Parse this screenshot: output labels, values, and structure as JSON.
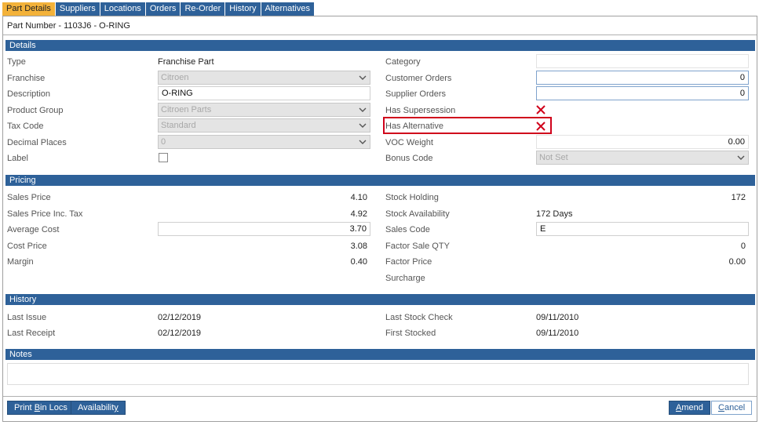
{
  "tabs": [
    {
      "label": "Part Details",
      "active": true
    },
    {
      "label": "Suppliers",
      "active": false
    },
    {
      "label": "Locations",
      "active": false
    },
    {
      "label": "Orders",
      "active": false
    },
    {
      "label": "Re-Order",
      "active": false
    },
    {
      "label": "History",
      "active": false
    },
    {
      "label": "Alternatives",
      "active": false
    }
  ],
  "part_title": "Part Number - 1103J6 - O-RING",
  "sections": {
    "details": "Details",
    "pricing": "Pricing",
    "history": "History",
    "notes": "Notes"
  },
  "details": {
    "type_label": "Type",
    "type_value": "Franchise Part",
    "franchise_label": "Franchise",
    "franchise_value": "Citroen",
    "description_label": "Description",
    "description_value": "O-RING",
    "product_group_label": "Product Group",
    "product_group_value": "Citroen Parts",
    "tax_code_label": "Tax Code",
    "tax_code_value": "Standard",
    "decimal_places_label": "Decimal Places",
    "decimal_places_value": "0",
    "label_label": "Label",
    "label_checked": false,
    "category_label": "Category",
    "category_value": "",
    "customer_orders_label": "Customer Orders",
    "customer_orders_value": "0",
    "supplier_orders_label": "Supplier Orders",
    "supplier_orders_value": "0",
    "has_supersession_label": "Has Supersession",
    "has_supersession_value": false,
    "has_alternative_label": "Has Alternative",
    "has_alternative_value": false,
    "voc_weight_label": "VOC Weight",
    "voc_weight_value": "0.00",
    "bonus_code_label": "Bonus Code",
    "bonus_code_value": "Not Set"
  },
  "pricing": {
    "sales_price_label": "Sales Price",
    "sales_price_value": "4.10",
    "sales_price_inc_tax_label": "Sales Price Inc. Tax",
    "sales_price_inc_tax_value": "4.92",
    "average_cost_label": "Average Cost",
    "average_cost_value": "3.70",
    "cost_price_label": "Cost Price",
    "cost_price_value": "3.08",
    "margin_label": "Margin",
    "margin_value": "0.40",
    "stock_holding_label": "Stock Holding",
    "stock_holding_value": "172",
    "stock_availability_label": "Stock Availability",
    "stock_availability_value": "172 Days",
    "sales_code_label": "Sales Code",
    "sales_code_value": "E",
    "factor_sale_qty_label": "Factor Sale QTY",
    "factor_sale_qty_value": "0",
    "factor_price_label": "Factor Price",
    "factor_price_value": "0.00",
    "surcharge_label": "Surcharge",
    "surcharge_value": ""
  },
  "history": {
    "last_issue_label": "Last Issue",
    "last_issue_value": "02/12/2019",
    "last_receipt_label": "Last Receipt",
    "last_receipt_value": "02/12/2019",
    "last_stock_check_label": "Last Stock Check",
    "last_stock_check_value": "09/11/2010",
    "first_stocked_label": "First Stocked",
    "first_stocked_value": "09/11/2010"
  },
  "notes": {
    "value": ""
  },
  "buttons": {
    "print_bin_locs_pre": "Print ",
    "print_bin_locs_u": "B",
    "print_bin_locs_post": "in Locs",
    "availability_pre": "Availabilit",
    "availability_u": "y",
    "availability_post": "",
    "amend_pre": "",
    "amend_u": "A",
    "amend_post": "mend",
    "cancel_pre": "",
    "cancel_u": "C",
    "cancel_post": "ancel"
  },
  "colors": {
    "header_blue": "#2e6199",
    "active_tab": "#f3b23a",
    "false_icon_red": "#d0021b"
  },
  "icons": {
    "dropdown": "chevron-down-icon",
    "false": "x-mark-icon"
  }
}
